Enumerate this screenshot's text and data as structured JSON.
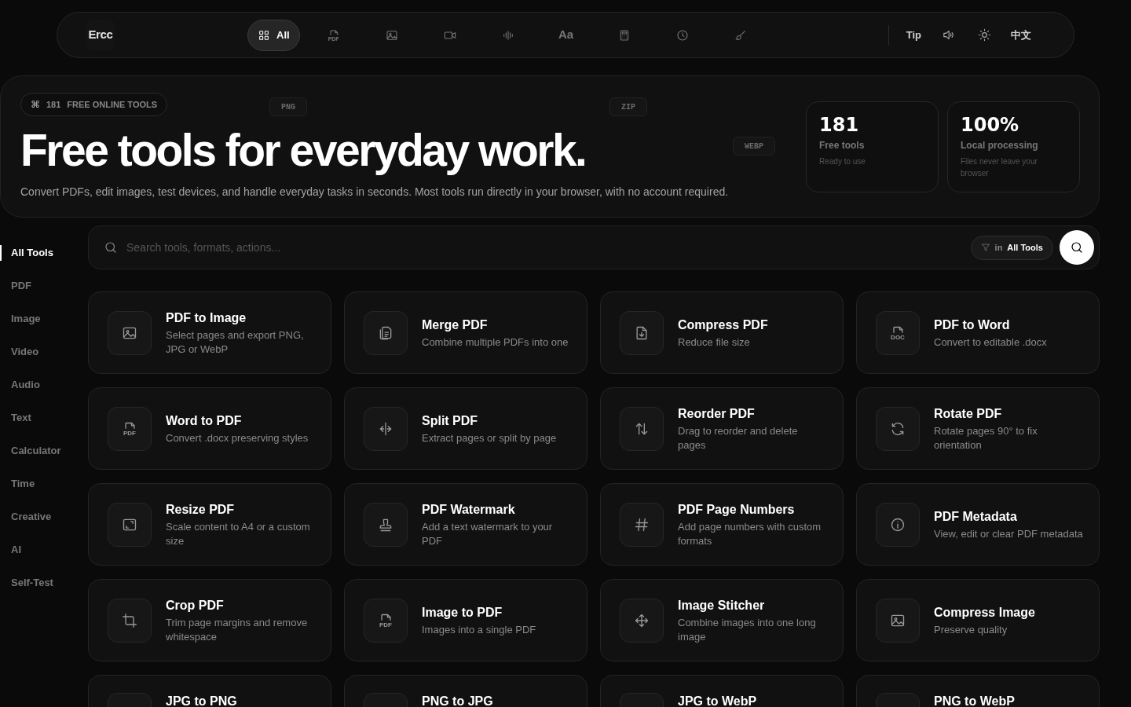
{
  "brand": "Ercc",
  "nav": [
    {
      "kind": "grid",
      "label": "All",
      "selected": true
    },
    {
      "kind": "file-label",
      "icon_text": "PDF",
      "selected": false
    },
    {
      "kind": "image",
      "selected": false
    },
    {
      "kind": "video",
      "selected": false
    },
    {
      "kind": "wave",
      "selected": false
    },
    {
      "kind": "type",
      "glyph": "Aa",
      "selected": false
    },
    {
      "kind": "calculator",
      "selected": false
    },
    {
      "kind": "clock",
      "selected": false
    },
    {
      "kind": "brush",
      "selected": false
    }
  ],
  "nav_right": [
    {
      "kind": "text",
      "label": "Tip"
    },
    {
      "kind": "speaker"
    },
    {
      "kind": "sun"
    },
    {
      "kind": "text",
      "label": "中文"
    }
  ],
  "hero": {
    "badge_icon": "⌘",
    "badge_count": "181",
    "badge_label": "FREE ONLINE TOOLS",
    "title": "Free tools for everyday work.",
    "subtitle": "Convert PDFs, edit images, test devices, and handle everyday tasks in seconds. Most tools run directly in your browser, with no account required.",
    "floating_tags": [
      "PNG",
      "ZIP",
      "WEBP"
    ],
    "stats": [
      {
        "value": "181",
        "label": "Free tools",
        "note": "Ready to use"
      },
      {
        "value": "100%",
        "label": "Local processing",
        "note": "Files never leave your browser"
      }
    ]
  },
  "sidebar": [
    {
      "label": "All Tools",
      "selected": true
    },
    {
      "label": "PDF",
      "selected": false
    },
    {
      "label": "Image",
      "selected": false
    },
    {
      "label": "Video",
      "selected": false
    },
    {
      "label": "Audio",
      "selected": false
    },
    {
      "label": "Text",
      "selected": false
    },
    {
      "label": "Calculator",
      "selected": false
    },
    {
      "label": "Time",
      "selected": false
    },
    {
      "label": "Creative",
      "selected": false
    },
    {
      "label": "AI",
      "selected": false
    },
    {
      "label": "Self-Test",
      "selected": false
    }
  ],
  "search": {
    "placeholder": "Search tools, formats, actions...",
    "scope_prefix": "in",
    "scope": "All Tools"
  },
  "tools": [
    {
      "kind": "image",
      "title": "PDF to Image",
      "description": "Select pages and export PNG, JPG or WebP"
    },
    {
      "kind": "files",
      "title": "Merge PDF",
      "description": "Combine multiple PDFs into one"
    },
    {
      "kind": "file-down",
      "title": "Compress PDF",
      "description": "Reduce file size"
    },
    {
      "kind": "file-label",
      "icon_text": "DOC",
      "title": "PDF to Word",
      "description": "Convert to editable .docx"
    },
    {
      "kind": "file-label",
      "icon_text": "PDF",
      "title": "Word to PDF",
      "description": "Convert .docx preserving styles"
    },
    {
      "kind": "split",
      "title": "Split PDF",
      "description": "Extract pages or split by page"
    },
    {
      "kind": "updown",
      "title": "Reorder PDF",
      "description": "Drag to reorder and delete pages"
    },
    {
      "kind": "rotate",
      "title": "Rotate PDF",
      "description": "Rotate pages 90° to fix orientation"
    },
    {
      "kind": "resize",
      "title": "Resize PDF",
      "description": "Scale content to A4 or a custom size"
    },
    {
      "kind": "stamp",
      "title": "PDF Watermark",
      "description": "Add a text watermark to your PDF"
    },
    {
      "kind": "hash",
      "title": "PDF Page Numbers",
      "description": "Add page numbers with custom formats"
    },
    {
      "kind": "info",
      "title": "PDF Metadata",
      "description": "View, edit or clear PDF metadata"
    },
    {
      "kind": "crop",
      "title": "Crop PDF",
      "description": "Trim page margins and remove whitespace"
    },
    {
      "kind": "file-label",
      "icon_text": "PDF",
      "title": "Image to PDF",
      "description": "Images into a single PDF"
    },
    {
      "kind": "move",
      "title": "Image Stitcher",
      "description": "Combine images into one long image"
    },
    {
      "kind": "image",
      "title": "Compress Image",
      "description": "Preserve quality"
    },
    {
      "title": "JPG to PNG"
    },
    {
      "title": "PNG to JPG"
    },
    {
      "title": "JPG to WebP"
    },
    {
      "title": "PNG to WebP"
    }
  ]
}
